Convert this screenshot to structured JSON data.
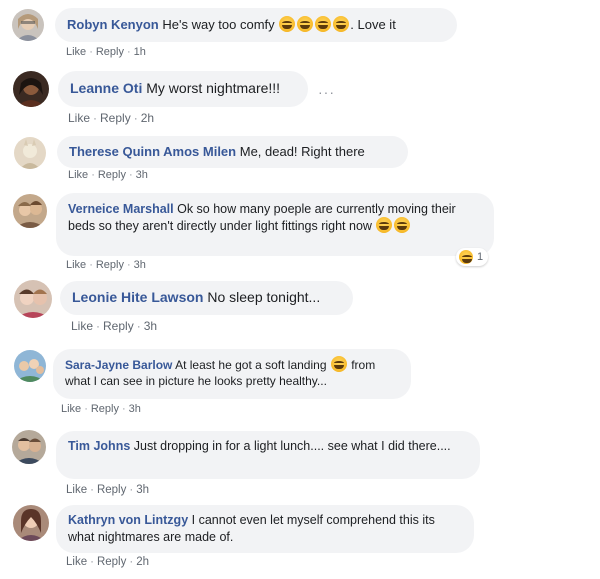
{
  "comments": [
    {
      "author": "Robyn Kenyon",
      "text": "He's way too comfy",
      "text_after": ". Love it",
      "like": "Like",
      "reply": "Reply",
      "time": "1h"
    },
    {
      "author": "Leanne Oti",
      "text": "My worst nightmare!!!",
      "more": "···",
      "like": "Like",
      "reply": "Reply",
      "time": "2h"
    },
    {
      "author": "Therese Quinn Amos Milen",
      "text": "Me, dead! Right there",
      "like": "Like",
      "reply": "Reply",
      "time": "3h"
    },
    {
      "author": "Verneice Marshall",
      "text": "Ok so how many poeple are currently moving their beds so they aren't directly under light fittings right now",
      "reaction_count": "1",
      "like": "Like",
      "reply": "Reply",
      "time": "3h"
    },
    {
      "author": "Leonie Hite Lawson",
      "text": "No sleep tonight...",
      "like": "Like",
      "reply": "Reply",
      "time": "3h"
    },
    {
      "author": "Sara-Jayne Barlow",
      "text": "At least he got a soft landing",
      "text_after": "from what I can see in picture he looks pretty healthy...",
      "like": "Like",
      "reply": "Reply",
      "time": "3h"
    },
    {
      "author": "Tim Johns",
      "text": "Just dropping in for a light lunch.... see what I did there....",
      "like": "Like",
      "reply": "Reply",
      "time": "3h"
    },
    {
      "author": "Kathryn von Lintzgy",
      "text": "I cannot even let myself comprehend this its what nightmares are made of.",
      "like": "Like",
      "reply": "Reply",
      "time": "2h"
    }
  ]
}
